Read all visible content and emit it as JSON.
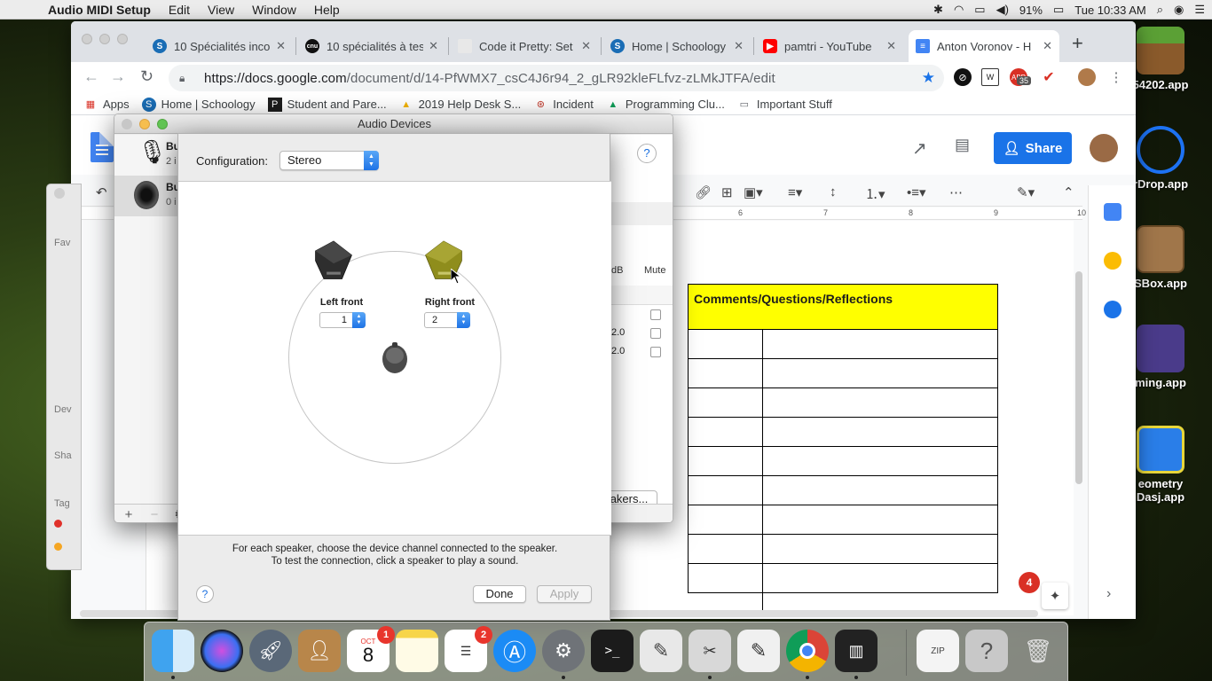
{
  "menubar": {
    "app_name": "Audio MIDI Setup",
    "items": [
      "Edit",
      "View",
      "Window",
      "Help"
    ],
    "battery": "91%",
    "clock": "Tue 10:33 AM"
  },
  "desktop_icons": [
    {
      "label": "54202.app"
    },
    {
      "label": "rDrop.app"
    },
    {
      "label": "SBox.app"
    },
    {
      "label": "ming.app"
    },
    {
      "label": "eometry"
    },
    {
      "label": "Dasj.app"
    }
  ],
  "browser": {
    "tabs": [
      {
        "title": "10 Spécialités inco",
        "favicon": "schoology-icon"
      },
      {
        "title": "10 spécialités à tes",
        "favicon": "cnu-icon"
      },
      {
        "title": "Code it Pretty: Set",
        "favicon": "page-icon"
      },
      {
        "title": "Home | Schoology",
        "favicon": "schoology-icon"
      },
      {
        "title": "pamtri - YouTube",
        "favicon": "youtube-icon"
      },
      {
        "title": "Anton Voronov - H",
        "favicon": "docs-icon"
      }
    ],
    "url_host": "https://docs.google.com",
    "url_path": "/document/d/14-PfWMX7_csC4J6r94_2_gLR92kleFLfvz-zLMkJTFA/edit",
    "ext_badge": "35",
    "bookmarks": [
      {
        "label": "Apps"
      },
      {
        "label": "Home | Schoology"
      },
      {
        "label": "Student and Pare..."
      },
      {
        "label": "2019 Help Desk S..."
      },
      {
        "label": "Incident"
      },
      {
        "label": "Programming Clu..."
      },
      {
        "label": "Important Stuff"
      }
    ]
  },
  "docs": {
    "share_label": "Share",
    "ruler_ticks": [
      "6",
      "7",
      "8",
      "9",
      "10"
    ],
    "table_header": "Comments/Questions/Reflections",
    "notification_count": "4"
  },
  "audio_devices": {
    "title": "Audio Devices",
    "devices": [
      {
        "name": "Bu",
        "sub": "2 i"
      },
      {
        "name": "Bu",
        "sub": "0 i"
      }
    ],
    "col_db": "dB",
    "col_mute": "Mute",
    "values": [
      "2.0",
      "2.0"
    ],
    "speakers_button": "akers..."
  },
  "speaker_sheet": {
    "config_label": "Configuration:",
    "config_value": "Stereo",
    "left_label": "Left front",
    "left_channel": "1",
    "right_label": "Right front",
    "right_channel": "2",
    "instruction_1": "For each speaker, choose the device channel connected to the speaker.",
    "instruction_2": "To test the connection, click a speaker to play a sound.",
    "done_label": "Done",
    "apply_label": "Apply",
    "help_label": "?"
  },
  "dock": {
    "calendar_month": "OCT",
    "calendar_day": "8",
    "calendar_badge": "1",
    "reminders_badge": "2"
  },
  "colors": {
    "docs_blue": "#1a73e8",
    "table_header_yellow": "#ffff00",
    "right_speaker_olive": "#8f8d1c"
  }
}
